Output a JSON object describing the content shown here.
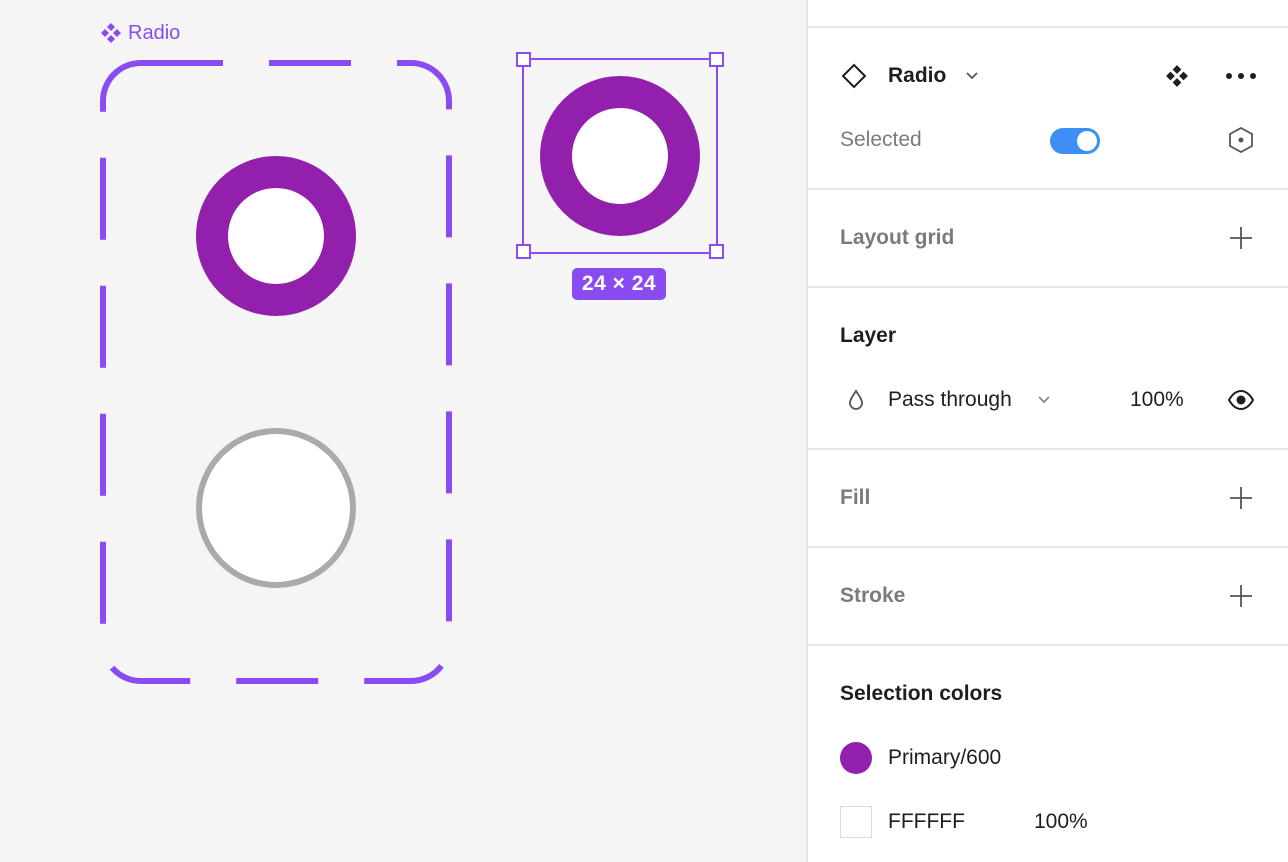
{
  "canvas": {
    "component_set_label": "Radio",
    "dimension_badge": "24 × 24"
  },
  "panel": {
    "component": {
      "name": "Radio",
      "property_label": "Selected",
      "property_value": true
    },
    "layout_grid": {
      "title": "Layout grid"
    },
    "layer": {
      "title": "Layer",
      "blend_mode": "Pass through",
      "opacity": "100%"
    },
    "fill": {
      "title": "Fill"
    },
    "stroke": {
      "title": "Stroke"
    },
    "selection_colors": {
      "title": "Selection colors",
      "items": [
        {
          "name": "Primary/600",
          "color": "#931fad",
          "opacity": ""
        },
        {
          "name": "FFFFFF",
          "color": "#ffffff",
          "opacity": "100%"
        }
      ]
    }
  },
  "colors": {
    "accent": "#8a4cf2",
    "primary": "#931fad",
    "unselected_ring": "#aaaaaa",
    "toggle_on": "#3c8ff5"
  }
}
